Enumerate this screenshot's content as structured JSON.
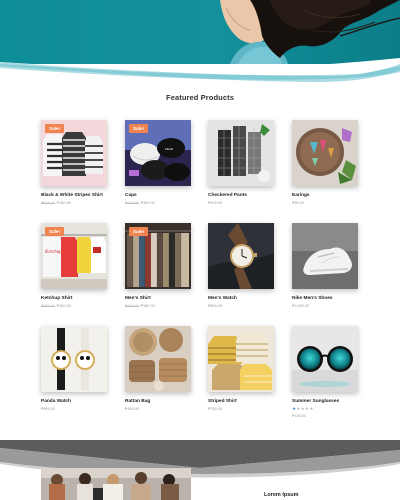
{
  "featured": {
    "title": "Featured Products",
    "sale_label": "Sale!",
    "products": [
      {
        "name": "Black & White Stripes Shirt",
        "old_price": "₱400.00",
        "price": "₱180.00",
        "sale": true
      },
      {
        "name": "Caps",
        "old_price": "₱400.00",
        "price": "₱300.00",
        "sale": true
      },
      {
        "name": "Checkered Pants",
        "old_price": "",
        "price": "₱400.00",
        "sale": false
      },
      {
        "name": "Earings",
        "old_price": "",
        "price": "₱80.00",
        "sale": false
      },
      {
        "name": "Ketchup Shirt",
        "old_price": "₱400.00",
        "price": "₱300.00",
        "sale": true
      },
      {
        "name": "Men's Shirt",
        "old_price": "₱400.00",
        "price": "₱180.00",
        "sale": true
      },
      {
        "name": "Men's Watch",
        "old_price": "",
        "price": "₱800.00",
        "sale": false
      },
      {
        "name": "Nike Men's Shoes",
        "old_price": "",
        "price": "₱2,000.00",
        "sale": false
      },
      {
        "name": "Panda Watch",
        "old_price": "",
        "price": "₱800.00",
        "sale": false
      },
      {
        "name": "Rattan Bag",
        "old_price": "",
        "price": "₱350.00",
        "sale": false
      },
      {
        "name": "Striped Shirt",
        "old_price": "",
        "price": "₱250.00",
        "sale": false
      },
      {
        "name": "Summer Sunglasses",
        "old_price": "",
        "price": "₱150.00",
        "sale": false,
        "rating": 1
      }
    ]
  },
  "promo": {
    "heading": "Lorem Ipsum"
  },
  "colors": {
    "teal": "#0e8c98",
    "sale_badge": "#f0834f",
    "star": "#3b85d8"
  }
}
